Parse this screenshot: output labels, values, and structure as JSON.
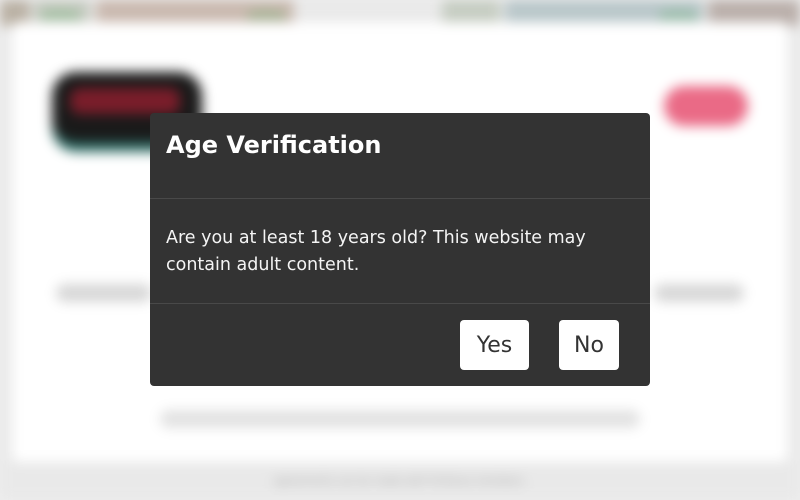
{
  "background": {
    "online_badges": [
      "online",
      "online",
      "online"
    ],
    "footer_text": "agreements can be made with fictitious members."
  },
  "dialog": {
    "title": "Age Verification",
    "message": "Are you at least 18 years old? This website may contain adult content.",
    "yes_label": "Yes",
    "no_label": "No"
  },
  "colors": {
    "dialog_bg": "#333333",
    "button_bg": "#ffffff",
    "text": "#ffffff",
    "online_badge": "#3fa14a"
  }
}
